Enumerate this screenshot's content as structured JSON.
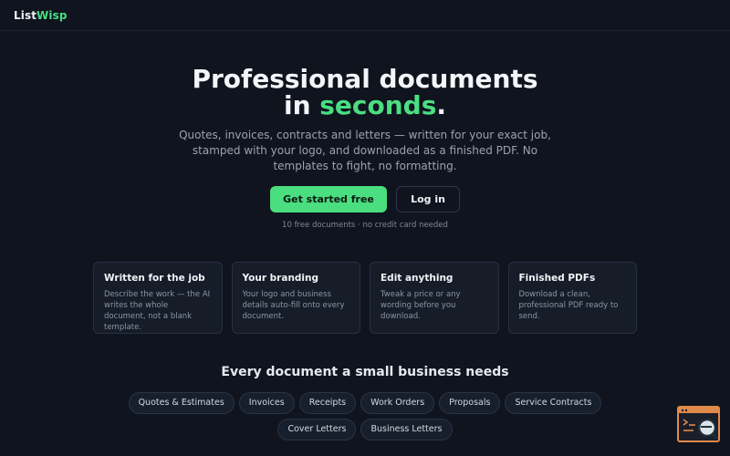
{
  "brand": {
    "name_part1": "List",
    "name_part2": "Wisp",
    "accent_color": "#4ade80"
  },
  "hero": {
    "title_line1": "Professional documents",
    "title_line2_prefix": "in ",
    "title_line2_highlight": "seconds",
    "title_line2_suffix": ".",
    "subtitle": "Quotes, invoices, contracts and letters — written for your exact job, stamped with your logo, and downloaded as a finished PDF. No templates to fight, no formatting.",
    "primary_cta": "Get started free",
    "secondary_cta": "Log in",
    "note": "10 free documents · no credit card needed"
  },
  "features": [
    {
      "title": "Written for the job",
      "desc": "Describe the work — the AI writes the whole document, not a blank template."
    },
    {
      "title": "Your branding",
      "desc": "Your logo and business details auto-fill onto every document."
    },
    {
      "title": "Edit anything",
      "desc": "Tweak a price or any wording before you download."
    },
    {
      "title": "Finished PDFs",
      "desc": "Download a clean, professional PDF ready to send."
    }
  ],
  "doc_section": {
    "title": "Every document a small business needs",
    "types": [
      "Quotes & Estimates",
      "Invoices",
      "Receipts",
      "Work Orders",
      "Proposals",
      "Service Contracts",
      "Cover Letters",
      "Business Letters"
    ]
  },
  "widget": {
    "icon": "browser-search-icon",
    "border_color": "#e08a4a"
  }
}
